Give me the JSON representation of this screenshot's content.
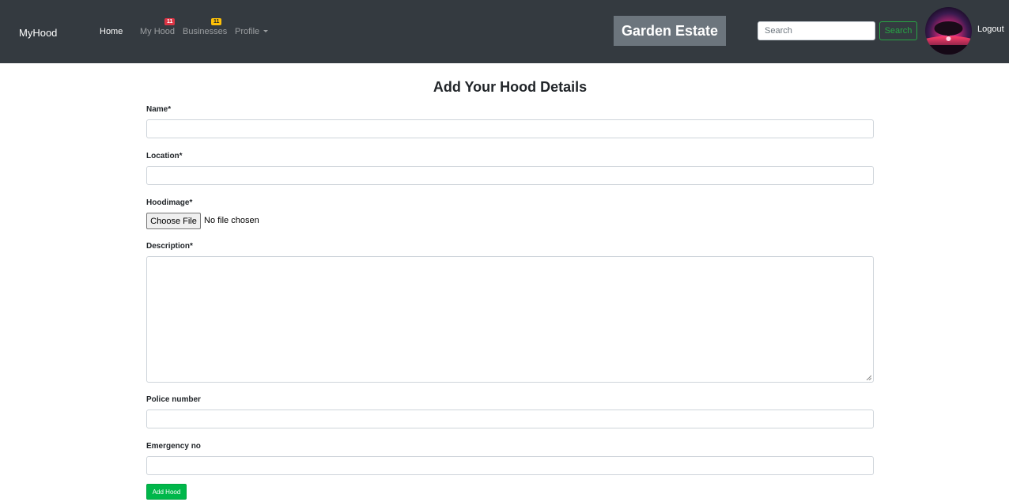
{
  "navbar": {
    "brand": "MyHood",
    "links": [
      {
        "label": "Home",
        "active": true
      },
      {
        "label": "My Hood",
        "badge": "11"
      },
      {
        "label": "Businesses",
        "badge": "11"
      },
      {
        "label": "Profile"
      }
    ],
    "estate_name": "Garden Estate",
    "search": {
      "placeholder": "Search",
      "button_label": "Search"
    },
    "logout_label": "Logout"
  },
  "form": {
    "title": "Add Your Hood Details",
    "fields": {
      "name": {
        "label": "Name*",
        "value": ""
      },
      "location": {
        "label": "Location*",
        "value": ""
      },
      "hoodimage": {
        "label": "Hoodimage*",
        "button_label": "Choose File",
        "status": "No file chosen"
      },
      "description": {
        "label": "Description*",
        "value": ""
      },
      "police_number": {
        "label": "Police number",
        "value": ""
      },
      "emergency_no": {
        "label": "Emergency no",
        "value": ""
      }
    },
    "submit_label": "Add Hood"
  },
  "colors": {
    "navbar_bg": "#343a40",
    "badge_red": "#dc3545",
    "badge_yellow": "#ffc107",
    "estate_chip_bg": "#6c757d",
    "search_outline": "#28a745",
    "submit_bg": "#00b74a"
  },
  "icons": {
    "profile_dropdown": "caret-down-icon",
    "textarea_resize": "resize-grip-icon"
  }
}
